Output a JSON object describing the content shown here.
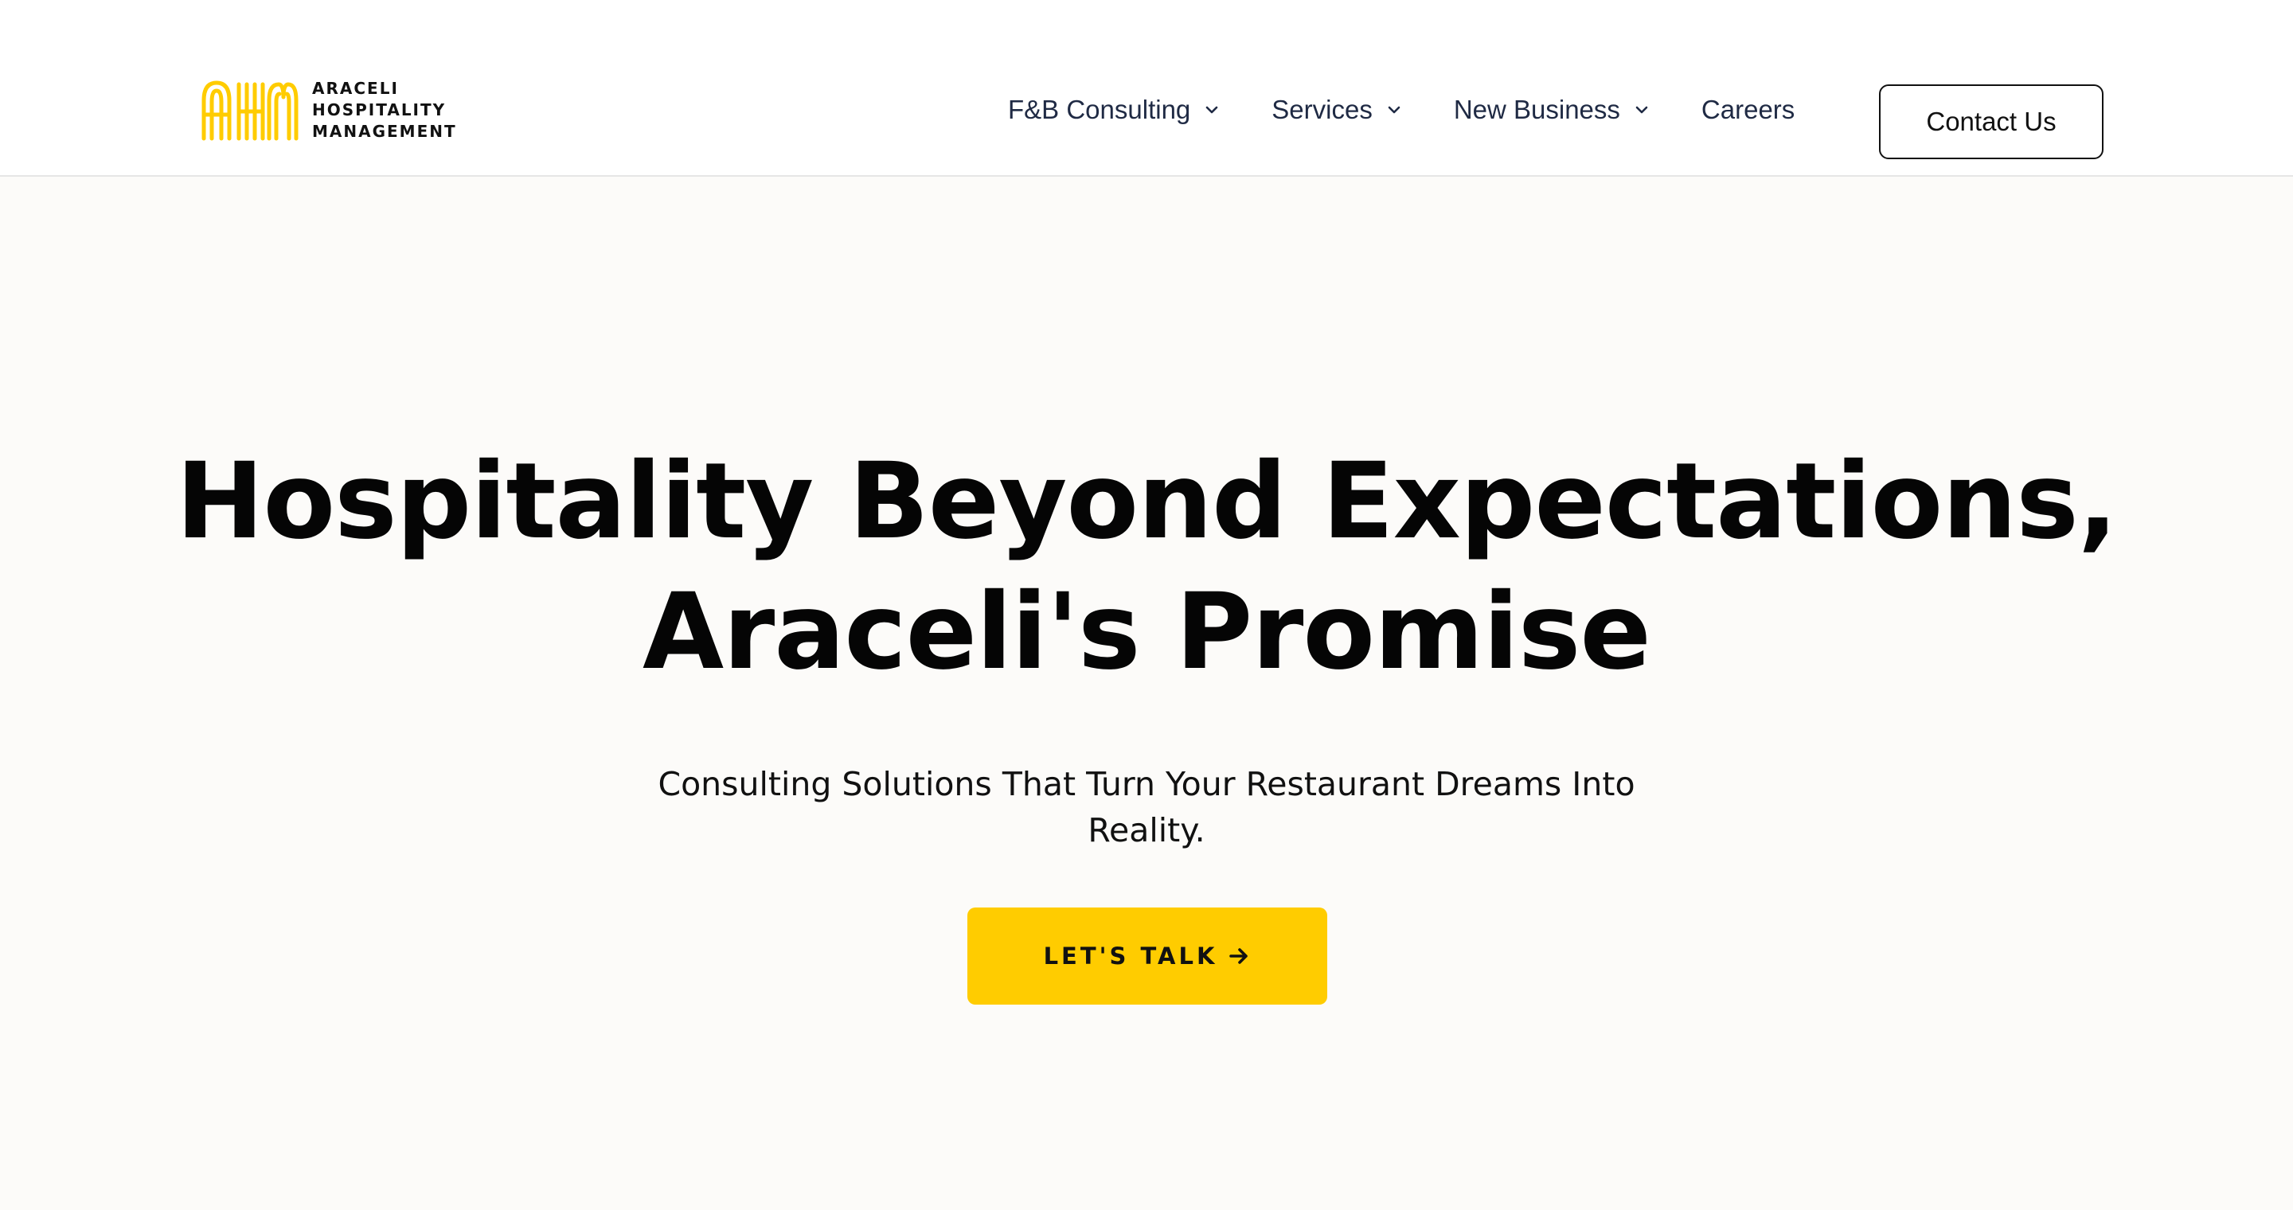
{
  "brand": {
    "logo_mark_letters": "AHM",
    "name_lines": [
      "ARACELI",
      "HOSPITALITY",
      "MANAGEMENT"
    ],
    "accent_color": "#ffcc00"
  },
  "nav": {
    "items": [
      {
        "label": "F&B Consulting",
        "has_dropdown": true,
        "icon": "chevron-down-icon"
      },
      {
        "label": "Services",
        "has_dropdown": true,
        "icon": "chevron-down-icon"
      },
      {
        "label": "New Business",
        "has_dropdown": true,
        "icon": "chevron-down-icon"
      },
      {
        "label": "Careers",
        "has_dropdown": false
      }
    ],
    "contact_label": "Contact Us"
  },
  "hero": {
    "title_lines": [
      "Hospitality Beyond Expectations,",
      "Araceli's Promise"
    ],
    "subtitle_lines": [
      "Consulting Solutions That Turn Your Restaurant Dreams Into",
      "Reality."
    ],
    "cta_label": "LET'S TALK",
    "cta_icon": "arrow-right-icon",
    "cta_color": "#ffcc00"
  }
}
